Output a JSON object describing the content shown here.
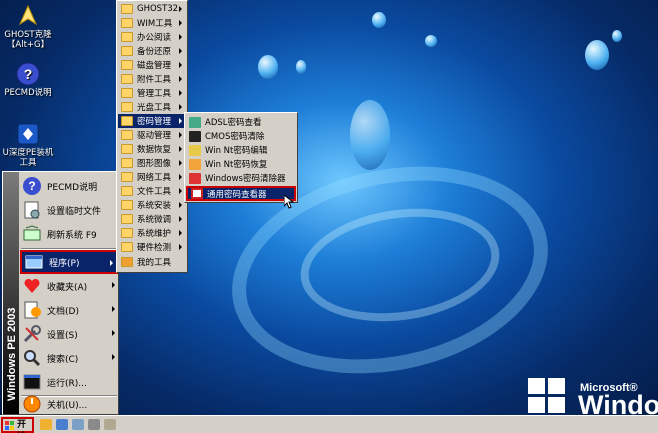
{
  "desktop_icons": [
    {
      "label_line1": "GHOST克隆",
      "label_line2": "【Alt+G】",
      "icon": "ghost-icon"
    },
    {
      "label_line1": "PECMD说明",
      "label_line2": "",
      "icon": "help-icon"
    },
    {
      "label_line1": "U深度PE装机",
      "label_line2": "工具",
      "icon": "installer-icon"
    }
  ],
  "start_menu": {
    "sidebar_text": "Windows PE 2003",
    "items": [
      {
        "label": "PECMD说明",
        "icon": "help-icon",
        "submenu": false
      },
      {
        "label": "设置临时文件",
        "icon": "settings-file-icon",
        "submenu": false
      },
      {
        "label": "刷新系统 F9",
        "icon": "refresh-icon",
        "submenu": false
      },
      {
        "label": "程序(P)",
        "icon": "programs-icon",
        "submenu": true
      },
      {
        "label": "收藏夹(A)",
        "icon": "favorites-icon",
        "submenu": true
      },
      {
        "label": "文档(D)",
        "icon": "documents-icon",
        "submenu": true
      },
      {
        "label": "设置(S)",
        "icon": "settings-icon",
        "submenu": true
      },
      {
        "label": "搜索(C)",
        "icon": "search-icon",
        "submenu": true
      },
      {
        "label": "运行(R)...",
        "icon": "run-icon",
        "submenu": false
      },
      {
        "label": "关机(U)...",
        "icon": "shutdown-icon",
        "submenu": false
      }
    ]
  },
  "programs_menu": {
    "items": [
      {
        "label": "GHOST32",
        "submenu": true
      },
      {
        "label": "WIM工具",
        "submenu": true
      },
      {
        "label": "办公阅读",
        "submenu": true
      },
      {
        "label": "备份还原",
        "submenu": true
      },
      {
        "label": "磁盘管理",
        "submenu": true
      },
      {
        "label": "附件工具",
        "submenu": true
      },
      {
        "label": "管理工具",
        "submenu": true
      },
      {
        "label": "光盘工具",
        "submenu": true
      },
      {
        "label": "密码管理",
        "submenu": true
      },
      {
        "label": "驱动管理",
        "submenu": true
      },
      {
        "label": "数据恢复",
        "submenu": true
      },
      {
        "label": "图形图像",
        "submenu": true
      },
      {
        "label": "网络工具",
        "submenu": true
      },
      {
        "label": "文件工具",
        "submenu": true
      },
      {
        "label": "系统安装",
        "submenu": true
      },
      {
        "label": "系统微调",
        "submenu": true
      },
      {
        "label": "系统维护",
        "submenu": true
      },
      {
        "label": "硬件检测",
        "submenu": true
      },
      {
        "label": "我的工具",
        "submenu": false
      }
    ]
  },
  "password_menu": {
    "items": [
      {
        "label": "ADSL密码查看",
        "icon": "adsl-icon"
      },
      {
        "label": "CMOS密码清除",
        "icon": "cmos-icon"
      },
      {
        "label": "Win Nt密码编辑",
        "icon": "key-edit-icon"
      },
      {
        "label": "Win Nt密码恢复",
        "icon": "key-restore-icon"
      },
      {
        "label": "Windows密码清除器",
        "icon": "key-clear-icon"
      },
      {
        "label": "通用密码查看器",
        "icon": "password-viewer-icon"
      }
    ]
  },
  "taskbar": {
    "start_label": "开始"
  },
  "brand": {
    "microsoft": "Microsoft®",
    "windows": "Window"
  },
  "colors": {
    "highlight": "#0a246a",
    "annotation": "#cc0000",
    "menu_bg": "#d4d0c8"
  }
}
